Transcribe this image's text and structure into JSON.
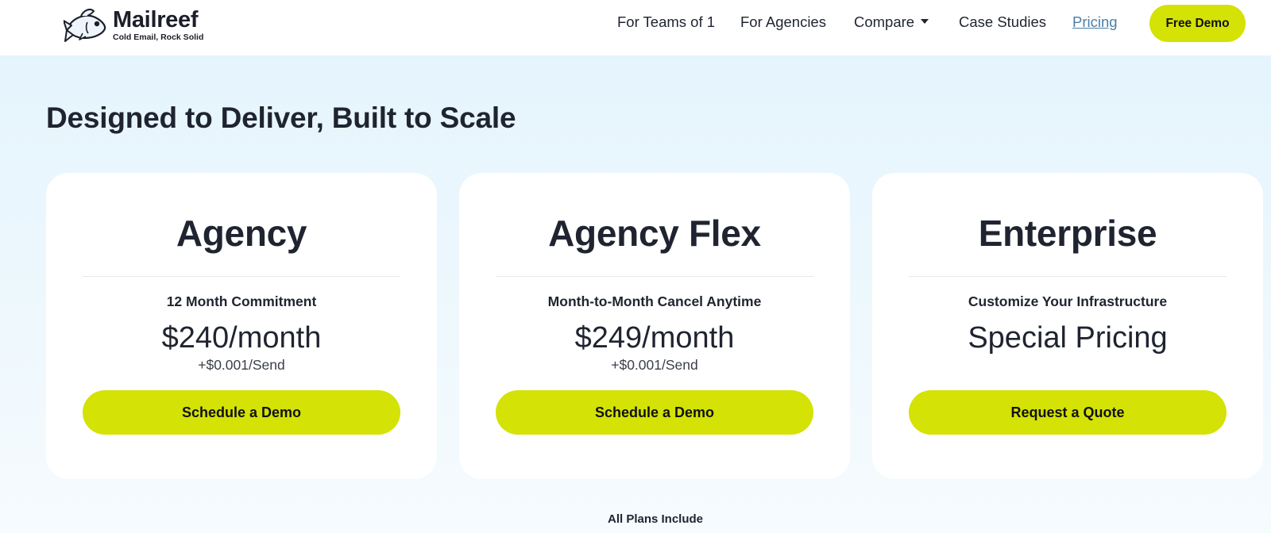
{
  "header": {
    "brand": {
      "name": "Mailreef",
      "tagline": "Cold Email, Rock Solid",
      "icon": "fish-logo-icon"
    },
    "nav": {
      "teams": "For Teams of 1",
      "agencies": "For Agencies",
      "compare": "Compare",
      "case_studies": "Case Studies",
      "pricing": "Pricing"
    },
    "cta": "Free Demo"
  },
  "hero": {
    "title": "Designed to Deliver, Built to Scale"
  },
  "plans": [
    {
      "name": "Agency",
      "commitment": "12 Month Commitment",
      "price": "$240/month",
      "per_send": "+$0.001/Send",
      "button": "Schedule a Demo"
    },
    {
      "name": "Agency Flex",
      "commitment": "Month-to-Month Cancel Anytime",
      "price": "$249/month",
      "per_send": "+$0.001/Send",
      "button": "Schedule a Demo"
    },
    {
      "name": "Enterprise",
      "commitment": "Customize Your Infrastructure",
      "price": "Special Pricing",
      "per_send": "",
      "button": "Request a Quote"
    }
  ],
  "plans_include": "All Plans Include",
  "colors": {
    "accent": "#d4e205",
    "text": "#1f2430",
    "link_active": "#4a7fa8",
    "hero_bg": "#e5f4fd"
  }
}
